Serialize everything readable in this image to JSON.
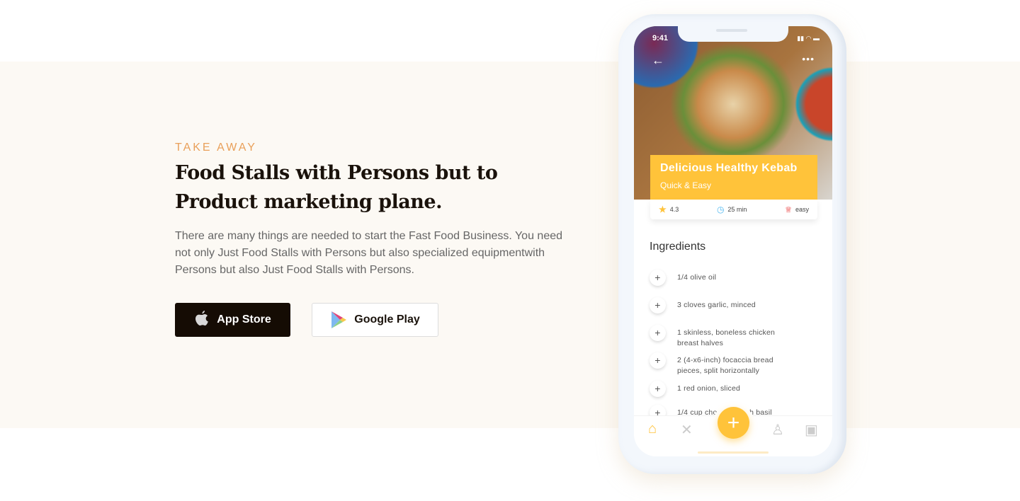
{
  "hero": {
    "eyebrow": "TAKE AWAY",
    "title_line1": "Food Stalls with Persons but  to",
    "title_line2": "Product marketing plane.",
    "description": "There are many things are needed to start the Fast Food Business. You need not only Just Food Stalls with Persons but also specialized equipmentwith Persons but also  Just Food Stalls with Persons.",
    "app_store_label": "App Store",
    "google_play_label": "Google Play"
  },
  "phone": {
    "time": "9:41",
    "recipe_name": "Delicious Healthy Kebab",
    "recipe_subtitle": "Quick & Easy",
    "rating": "4.3",
    "duration": "25 min",
    "difficulty": "easy",
    "ingredients_heading": "Ingredients",
    "ingredients": [
      "1/4 olive oil",
      "3 cloves garlic, minced",
      "1 skinless, boneless chicken breast halves",
      "2 (4-x6-inch) focaccia bread pieces, split horizontally",
      "1 red onion, sliced",
      "1/4 cup chopped fresh basil"
    ]
  },
  "colors": {
    "accent": "#ffc33a",
    "eyebrow": "#e9a05a",
    "dark": "#150c04",
    "band": "#fcf9f4"
  }
}
